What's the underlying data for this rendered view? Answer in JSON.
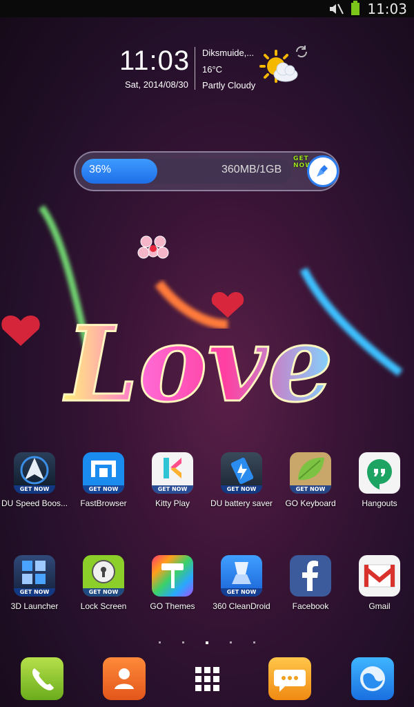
{
  "status_bar": {
    "time": "11:03"
  },
  "clock_widget": {
    "time": "11:03",
    "date": "Sat, 2014/08/30",
    "city": "Diksmuide,...",
    "temperature": "16°C",
    "condition": "Partly Cloudy"
  },
  "memory_widget": {
    "percent_label": "36%",
    "percent_value": 36,
    "size_label": "360MB/1GB",
    "get_now_label": "GET NOW"
  },
  "wallpaper": {
    "text": "Love"
  },
  "apps_row1": [
    {
      "label": "DU Speed Boos...",
      "get_now": "GET NOW"
    },
    {
      "label": "FastBrowser",
      "get_now": "GET NOW"
    },
    {
      "label": "Kitty Play",
      "get_now": "GET NOW"
    },
    {
      "label": "DU battery saver",
      "get_now": "GET NOW"
    },
    {
      "label": "GO Keyboard",
      "get_now": "GET NOW"
    },
    {
      "label": "Hangouts"
    }
  ],
  "apps_row2": [
    {
      "label": "3D Launcher",
      "get_now": "GET NOW"
    },
    {
      "label": "Lock Screen",
      "get_now": "GET NOW"
    },
    {
      "label": "GO Themes"
    },
    {
      "label": "360 CleanDroid",
      "get_now": "GET NOW"
    },
    {
      "label": "Facebook"
    },
    {
      "label": "Gmail"
    }
  ],
  "dock": [
    "phone-icon",
    "contacts-icon",
    "app-drawer-icon",
    "messaging-icon",
    "browser-icon"
  ],
  "colors": {
    "accent_blue": "#2b7df0",
    "battery_green": "#7cc51b"
  }
}
